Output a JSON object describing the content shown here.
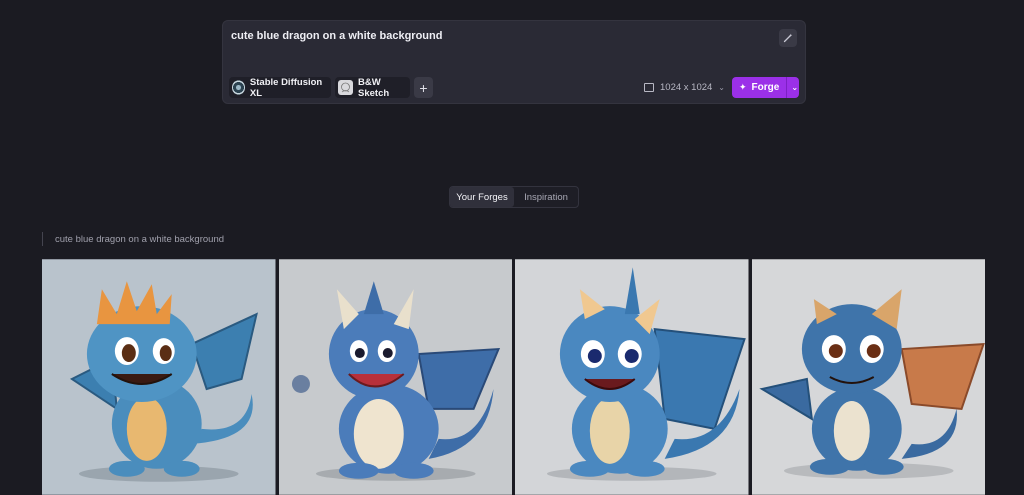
{
  "prompt": {
    "text": "cute blue dragon on a white background",
    "model_label": "Stable Diffusion XL",
    "style_label": "B&W Sketch",
    "add_label": "+",
    "size_label": "1024 x 1024",
    "forge_label": "Forge"
  },
  "tabs": [
    {
      "label": "Your Forges",
      "active": true
    },
    {
      "label": "Inspiration",
      "active": false
    }
  ],
  "gallery": {
    "group_label": "cute blue dragon on a white background",
    "images": [
      {
        "alt": "blue dragon 1",
        "bg": "#b9c3cc"
      },
      {
        "alt": "blue dragon 2",
        "bg": "#c7cacd"
      },
      {
        "alt": "blue dragon 3",
        "bg": "#d3d5d8"
      },
      {
        "alt": "blue dragon 4",
        "bg": "#d6d7d9"
      }
    ]
  },
  "colors": {
    "background": "#1b1b22",
    "panel": "#2a2a35",
    "accent": "#9b30e8"
  },
  "icons": [
    "magic-wand-icon",
    "image-icon",
    "chevron-down-icon",
    "sparkle-icon",
    "plus-icon"
  ]
}
